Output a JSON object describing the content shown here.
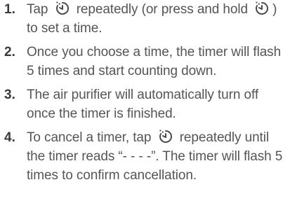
{
  "steps": [
    {
      "number": "1.",
      "parts": [
        "Tap ",
        " repeatedly (or press and hold ",
        ") to set a time."
      ]
    },
    {
      "number": "2.",
      "parts": [
        "Once you choose a time, the timer will flash 5 times and start counting down."
      ]
    },
    {
      "number": "3.",
      "parts": [
        "The air purifier will automatically turn off once the timer is finished."
      ]
    },
    {
      "number": "4.",
      "parts": [
        "To cancel a timer, tap ",
        " repeatedly until the timer reads “- - - -”. The timer will flash 5 times to confirm cancellation."
      ]
    }
  ],
  "icons": {
    "timer": "timer-icon"
  }
}
